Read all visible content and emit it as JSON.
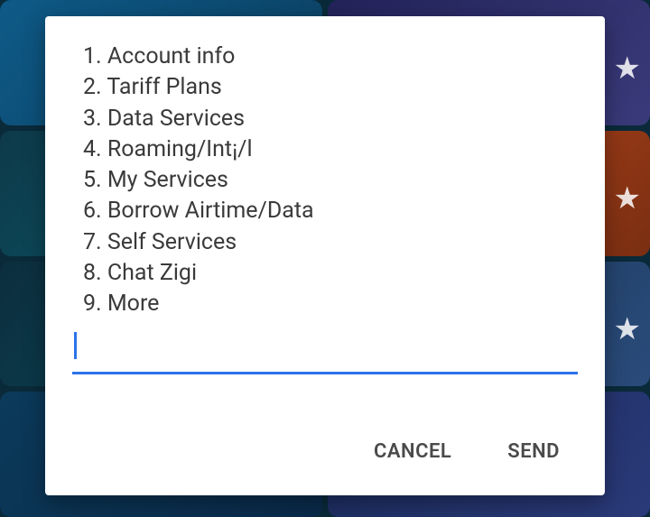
{
  "menu": {
    "items": [
      {
        "num": "1.",
        "label": "Account info"
      },
      {
        "num": "2.",
        "label": "Tariff Plans"
      },
      {
        "num": "3.",
        "label": "Data Services"
      },
      {
        "num": "4.",
        "label": "Roaming/Int¡/l"
      },
      {
        "num": "5.",
        "label": "My Services"
      },
      {
        "num": "6.",
        "label": "Borrow Airtime/Data"
      },
      {
        "num": "7.",
        "label": "Self Services"
      },
      {
        "num": "8.",
        "label": "Chat Zigi"
      },
      {
        "num": "9.",
        "label": "More"
      }
    ]
  },
  "input": {
    "value": "",
    "placeholder": ""
  },
  "actions": {
    "cancel": "CANCEL",
    "send": "SEND"
  }
}
